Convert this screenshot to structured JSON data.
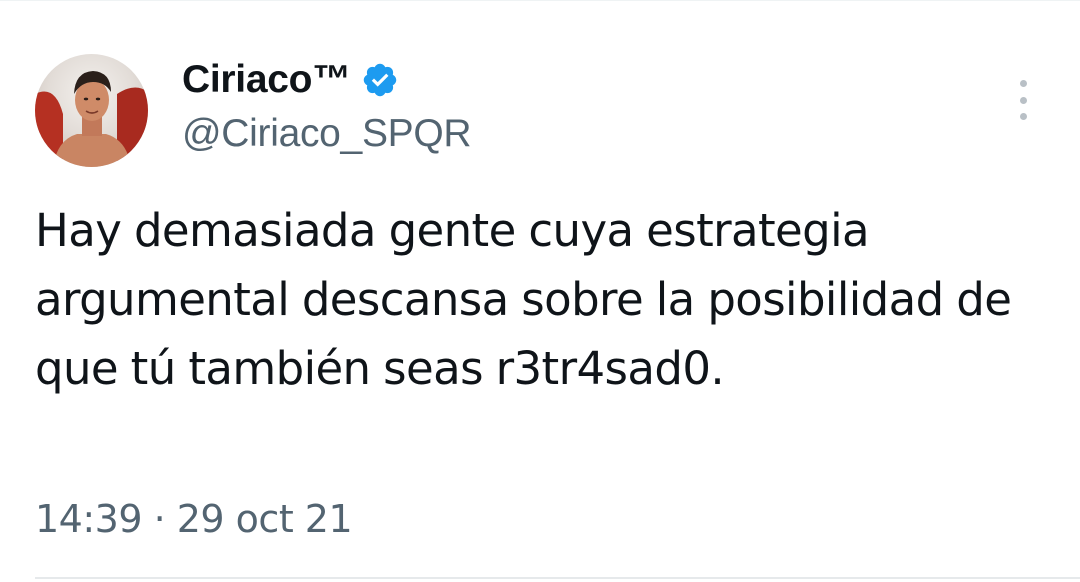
{
  "author": {
    "display_name": "Ciriaco™",
    "handle": "@Ciriaco_SPQR",
    "verified": true,
    "avatar_icon": "avatar-photo"
  },
  "tweet": {
    "text": "Hay demasiada gente cuya estrategia argumental descansa sobre la posibilidad de que tú también seas r3tr4sad0.",
    "timestamp": "14:39 · 29 oct 21"
  },
  "icons": {
    "verified": "verified-badge-icon",
    "more": "more-vertical-icon"
  },
  "colors": {
    "text_primary": "#0f1419",
    "text_secondary": "#536471",
    "verified_blue": "#1d9bf0",
    "more_dots": "#b9c0c6"
  }
}
